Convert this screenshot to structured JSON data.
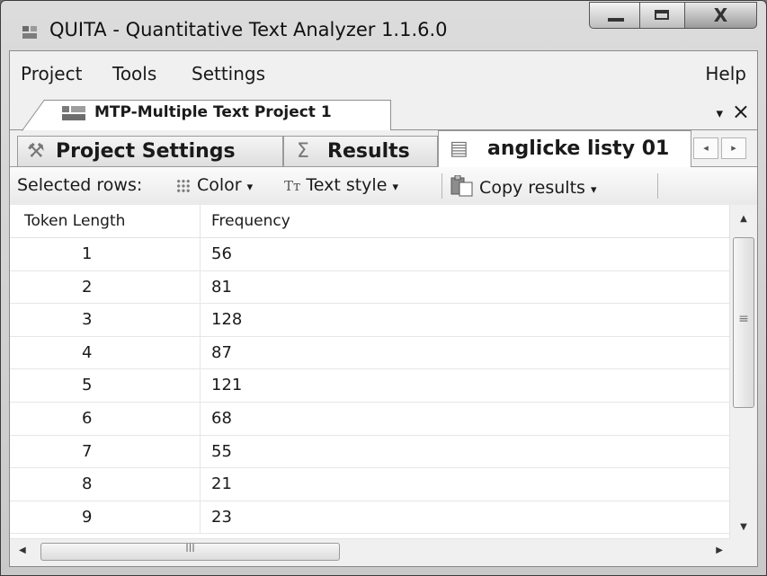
{
  "window": {
    "title": "QUITA - Quantitative Text Analyzer 1.1.6.0",
    "close_glyph": "X"
  },
  "menubar": {
    "items": [
      "Project",
      "Tools",
      "Settings"
    ],
    "help": "Help"
  },
  "document_tab": {
    "label": "MTP-Multiple Text Project 1",
    "dropdown_glyph": "▾",
    "close_glyph": "×"
  },
  "inner_tabs": [
    {
      "label": "Project Settings",
      "icon": "wrench-icon",
      "glyph": "⚒"
    },
    {
      "label": "Results",
      "icon": "sigma-icon",
      "glyph": "Σ"
    },
    {
      "label": "anglicke listy 01",
      "icon": "table-icon",
      "glyph": "▤",
      "active": true
    }
  ],
  "toolbar": {
    "selected_rows": "Selected rows:",
    "color": "Color",
    "text_style_glyph": "Tт",
    "text_style": "Text style",
    "copy_results": "Copy results",
    "dropdown_glyph": "▾"
  },
  "table": {
    "columns": [
      "Token Length",
      "Frequency"
    ],
    "rows": [
      [
        "1",
        "56"
      ],
      [
        "2",
        "81"
      ],
      [
        "3",
        "128"
      ],
      [
        "4",
        "87"
      ],
      [
        "5",
        "121"
      ],
      [
        "6",
        "68"
      ],
      [
        "7",
        "55"
      ],
      [
        "8",
        "21"
      ],
      [
        "9",
        "23"
      ]
    ]
  },
  "scroll": {
    "up": "▲",
    "down": "▼",
    "left": "◀",
    "right": "▶",
    "v_grip": "≡",
    "h_grip": "III",
    "tab_prev": "◂",
    "tab_next": "▸"
  },
  "colors": {
    "window_frame": "#c9c9c9",
    "client_bg": "#f0f0f0",
    "grid_bg": "#ffffff"
  }
}
